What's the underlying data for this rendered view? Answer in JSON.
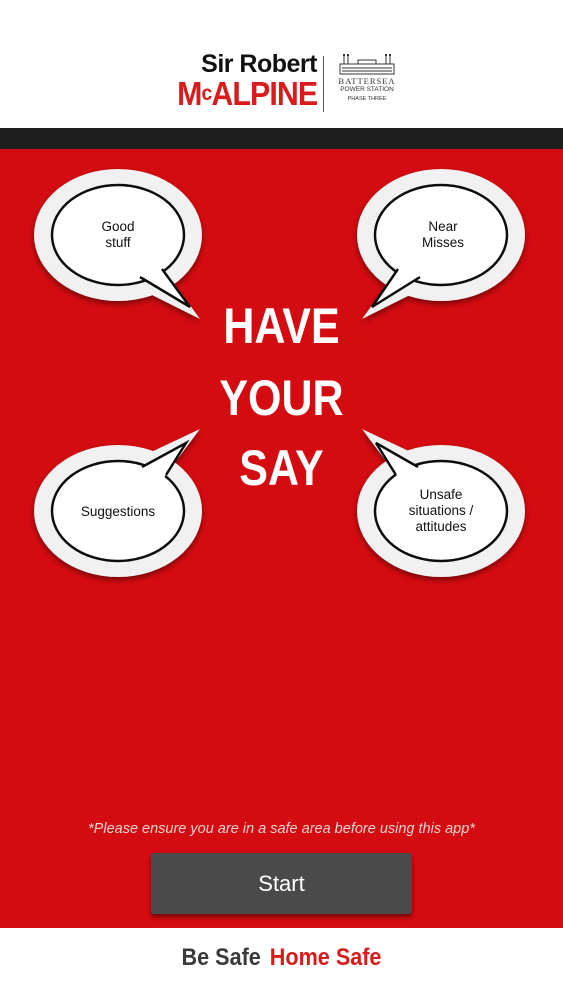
{
  "header": {
    "logo_line1": "Sir Robert",
    "logo_mc_prefix": "M",
    "logo_mc_c": "c",
    "logo_mc_rest": "ALPINE",
    "battersea_line1": "BATTERSEA",
    "battersea_line2": "POWER STATION",
    "battersea_line3": "PHASE THREE"
  },
  "bubbles": {
    "top_left": "Good\nstuff",
    "top_right": "Near\nMisses",
    "bottom_left": "Suggestions",
    "bottom_right": "Unsafe\nsituations /\nattitudes"
  },
  "headline": {
    "line1": "HAVE",
    "line2": "YOUR",
    "line3": "SAY"
  },
  "notice": "*Please ensure you are in a safe area before using this app*",
  "start_button": "Start",
  "footer": {
    "part1": "Be Safe",
    "part2": "Home Safe"
  },
  "colors": {
    "brand_red": "#d40b10",
    "button_gray": "#4a4a4a",
    "dark_bar": "#1f1f1f"
  }
}
